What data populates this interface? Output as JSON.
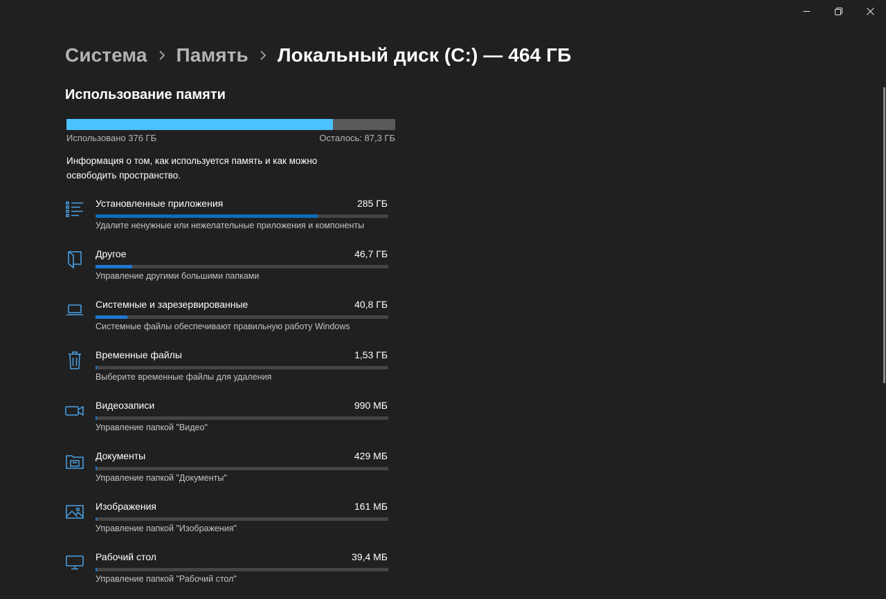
{
  "window": {
    "minimize_icon": "minimize-icon",
    "restore_icon": "restore-icon",
    "close_icon": "close-icon"
  },
  "breadcrumb": {
    "level1": "Система",
    "level2": "Память",
    "current": "Локальный диск (C:) — 464 ГБ"
  },
  "usage": {
    "title": "Использование памяти",
    "used_label": "Использовано 376 ГБ",
    "left_label": "Осталось: 87,3 ГБ",
    "used_fraction": 0.81,
    "info": "Информация о том, как используется память и как можно освободить пространство."
  },
  "categories": [
    {
      "icon": "apps-list-icon",
      "name": "Установленные приложения",
      "size": "285 ГБ",
      "fraction": 0.76,
      "desc": "Удалите ненужные или нежелательные приложения и компоненты"
    },
    {
      "icon": "other-folder-icon",
      "name": "Другое",
      "size": "46,7 ГБ",
      "fraction": 0.125,
      "desc": "Управление другими большими папками"
    },
    {
      "icon": "laptop-icon",
      "name": "Системные и зарезервированные",
      "size": "40,8 ГБ",
      "fraction": 0.108,
      "desc": "Системные файлы обеспечивают правильную работу Windows"
    },
    {
      "icon": "trash-icon",
      "name": "Временные файлы",
      "size": "1,53 ГБ",
      "fraction": 0.004,
      "desc": "Выберите временные файлы для удаления"
    },
    {
      "icon": "video-camera-icon",
      "name": "Видеозаписи",
      "size": "990 МБ",
      "fraction": 0.003,
      "desc": "Управление папкой \"Видео\""
    },
    {
      "icon": "documents-folder-icon",
      "name": "Документы",
      "size": "429 МБ",
      "fraction": 0.002,
      "desc": "Управление папкой \"Документы\""
    },
    {
      "icon": "image-icon",
      "name": "Изображения",
      "size": "161 МБ",
      "fraction": 0.001,
      "desc": "Управление папкой \"Изображения\""
    },
    {
      "icon": "desktop-monitor-icon",
      "name": "Рабочий стол",
      "size": "39,4 МБ",
      "fraction": 0.0005,
      "desc": "Управление папкой \"Рабочий стол\""
    }
  ],
  "colors": {
    "background": "#202020",
    "accent_light": "#4cc2ff",
    "accent_dark": "#0f6cbd",
    "icon": "#4aa3e8"
  }
}
